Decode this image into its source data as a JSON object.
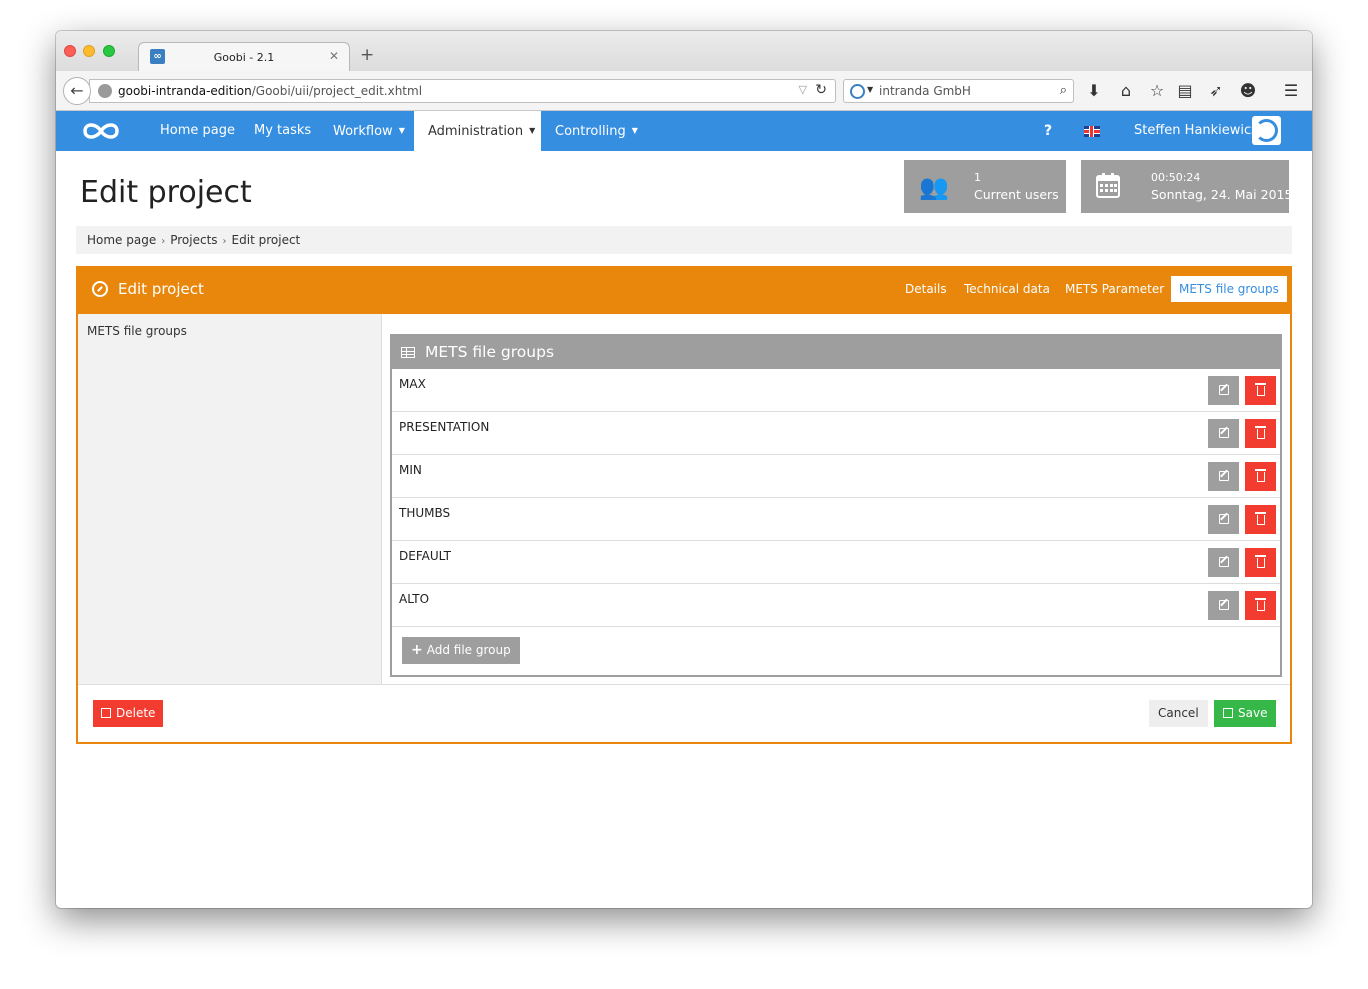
{
  "browser": {
    "tab_title": "Goobi - 2.1",
    "tab_favicon": "∞",
    "url_host": "goobi-intranda-edition",
    "url_path": "/Goobi/uii/project_edit.xhtml",
    "search_engine": "intranda GmbH",
    "toolbar_icons": [
      "download-icon",
      "home-icon",
      "bookmark-star-icon",
      "reading-list-icon",
      "send-icon",
      "chat-icon",
      "menu-icon"
    ]
  },
  "nav": {
    "items": [
      {
        "label": "Home page"
      },
      {
        "label": "My tasks"
      },
      {
        "label": "Workflow"
      },
      {
        "label": "Administration"
      },
      {
        "label": "Controlling"
      }
    ],
    "active": "Administration",
    "help": "?",
    "user_name": "Steffen Hankiewicz"
  },
  "header": {
    "title": "Edit project",
    "users_count": "1",
    "users_label": "Current users",
    "time": "00:50:24",
    "date": "Sonntag, 24. Mai 2015"
  },
  "breadcrumb": [
    "Home page",
    "Projects",
    "Edit project"
  ],
  "panel": {
    "title": "Edit project",
    "tabs": [
      {
        "label": "Details"
      },
      {
        "label": "Technical data"
      },
      {
        "label": "METS Parameter"
      },
      {
        "label": "METS file groups"
      }
    ],
    "active_tab": "METS file groups",
    "side_label": "METS file groups",
    "box_title": "METS file groups",
    "file_groups": [
      "MAX",
      "PRESENTATION",
      "MIN",
      "THUMBS",
      "DEFAULT",
      "ALTO"
    ],
    "add_label": "Add file group",
    "delete_label": "Delete",
    "cancel_label": "Cancel",
    "save_label": "Save"
  },
  "colors": {
    "nav_blue": "#368ee0",
    "panel_orange": "#e8870c",
    "danger_red": "#f13c2f",
    "save_green": "#35b847",
    "gray": "#9e9e9e"
  }
}
